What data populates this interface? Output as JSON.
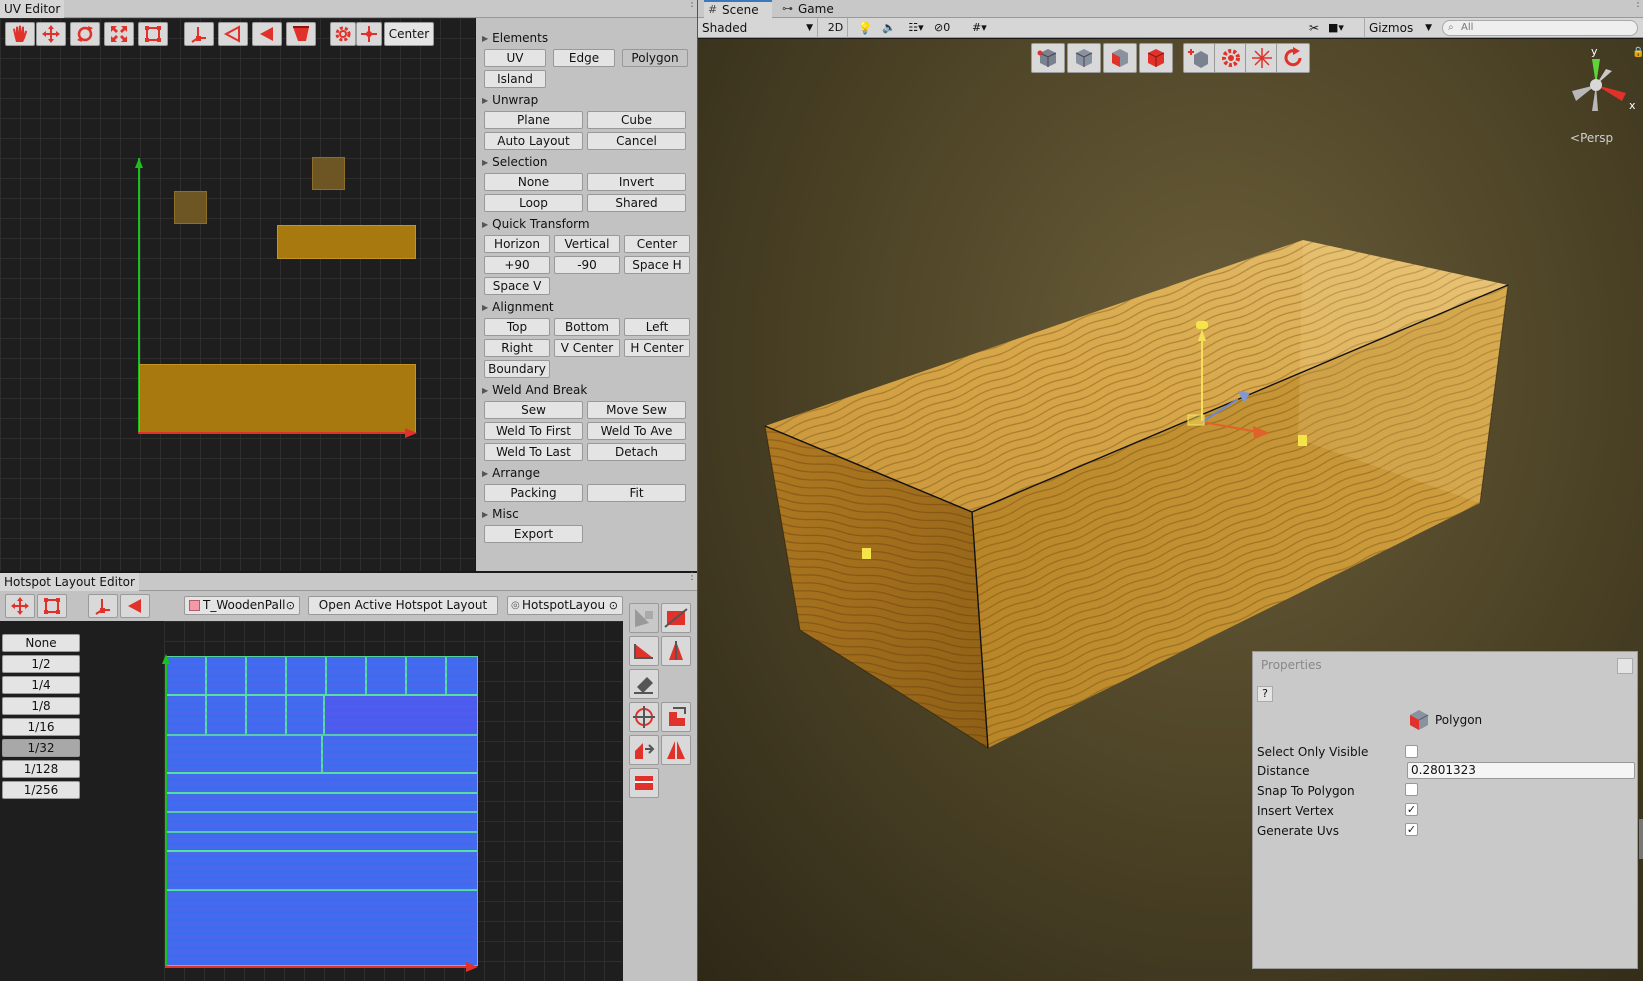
{
  "uv_editor": {
    "tab_label": "UV Editor",
    "center_label": "Center",
    "icons": [
      "hand-icon",
      "move-icon",
      "rotate-icon",
      "scale-icon",
      "rect-icon",
      "vertex-mode-icon",
      "edge-mode-icon",
      "face-mode-icon",
      "polygon-mode-icon",
      "settings-icon",
      "pivot-icon"
    ]
  },
  "actions": {
    "sections": {
      "elements": "Elements",
      "unwrap": "Unwrap",
      "selection": "Selection",
      "quick_transform": "Quick Transform",
      "alignment": "Alignment",
      "weld_and_break": "Weld And Break",
      "arrange": "Arrange",
      "misc": "Misc"
    },
    "elements": {
      "uv": "UV",
      "edge": "Edge",
      "polygon": "Polygon",
      "island": "Island"
    },
    "unwrap": {
      "plane": "Plane",
      "cube": "Cube",
      "auto_layout": "Auto Layout",
      "cancel": "Cancel"
    },
    "selection": {
      "none": "None",
      "invert": "Invert",
      "loop": "Loop",
      "shared": "Shared"
    },
    "quick_transform": {
      "horizon": "Horizon",
      "vertical": "Vertical",
      "center": "Center",
      "plus90": "+90",
      "minus90": "-90",
      "space_h": "Space H",
      "space_v": "Space V"
    },
    "alignment": {
      "top": "Top",
      "bottom": "Bottom",
      "left": "Left",
      "right": "Right",
      "v_center": "V Center",
      "h_center": "H Center",
      "boundary": "Boundary"
    },
    "weld": {
      "sew": "Sew",
      "move_sew": "Move Sew",
      "weld_first": "Weld To First",
      "weld_ave": "Weld To Ave",
      "weld_last": "Weld To Last",
      "detach": "Detach"
    },
    "arrange": {
      "packing": "Packing",
      "fit": "Fit"
    },
    "misc": {
      "export": "Export"
    }
  },
  "hotspot": {
    "tab_label": "Hotspot Layout Editor",
    "texture_field": "T_WoodenPall",
    "open_button": "Open Active Hotspot Layout",
    "layout_field": "HotspotLayou",
    "subdivisions": [
      "None",
      "1/2",
      "1/4",
      "1/8",
      "1/16",
      "1/32",
      "1/128",
      "1/256"
    ],
    "selected_subdivision": "1/32"
  },
  "scene": {
    "tabs": {
      "scene": "Scene",
      "game": "Game"
    },
    "shading": "Shaded",
    "mode_2d": "2D",
    "hidden_count": "0",
    "gizmos": "Gizmos",
    "search_placeholder": "All",
    "persp": "Persp",
    "axis": {
      "y": "y",
      "x": "x"
    }
  },
  "properties": {
    "title": "Properties",
    "help": "?",
    "tool_name": "Polygon",
    "rows": {
      "select_only_visible": {
        "label": "Select Only Visible",
        "checked": false
      },
      "distance": {
        "label": "Distance",
        "value": "0.2801323"
      },
      "snap_to_polygon": {
        "label": "Snap To Polygon",
        "checked": false
      },
      "insert_vertex": {
        "label": "Insert Vertex",
        "checked": true
      },
      "generate_uvs": {
        "label": "Generate Uvs",
        "checked": true
      }
    }
  },
  "colors": {
    "accent_red": "#e0322a",
    "uv_fill": "#a8790f",
    "hotspot_blue": "#3f6bf0",
    "tab_accent": "#3a79bb"
  }
}
